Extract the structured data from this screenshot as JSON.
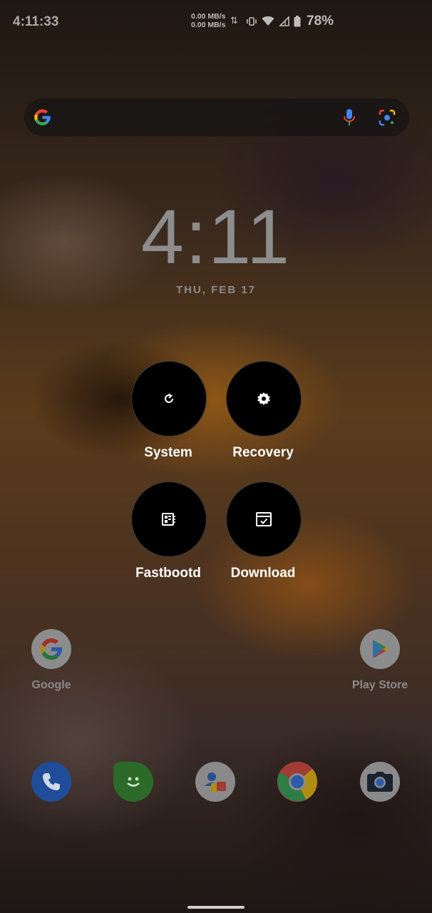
{
  "status_bar": {
    "time": "4:11:33",
    "net_up": "0.00 MB/s",
    "net_down": "0.00 MB/s",
    "battery": "78%"
  },
  "search": {
    "placeholder": ""
  },
  "clock": {
    "time": "4:11",
    "date": "THU, FEB 17"
  },
  "reboot_menu": {
    "system_label": "System",
    "recovery_label": "Recovery",
    "fastbootd_label": "Fastbootd",
    "download_label": "Download"
  },
  "home": {
    "google_label": "Google",
    "play_store_label": "Play Store"
  },
  "dock": [
    "phone-icon",
    "messages-icon",
    "contacts-icon",
    "chrome-icon",
    "camera-icon"
  ]
}
